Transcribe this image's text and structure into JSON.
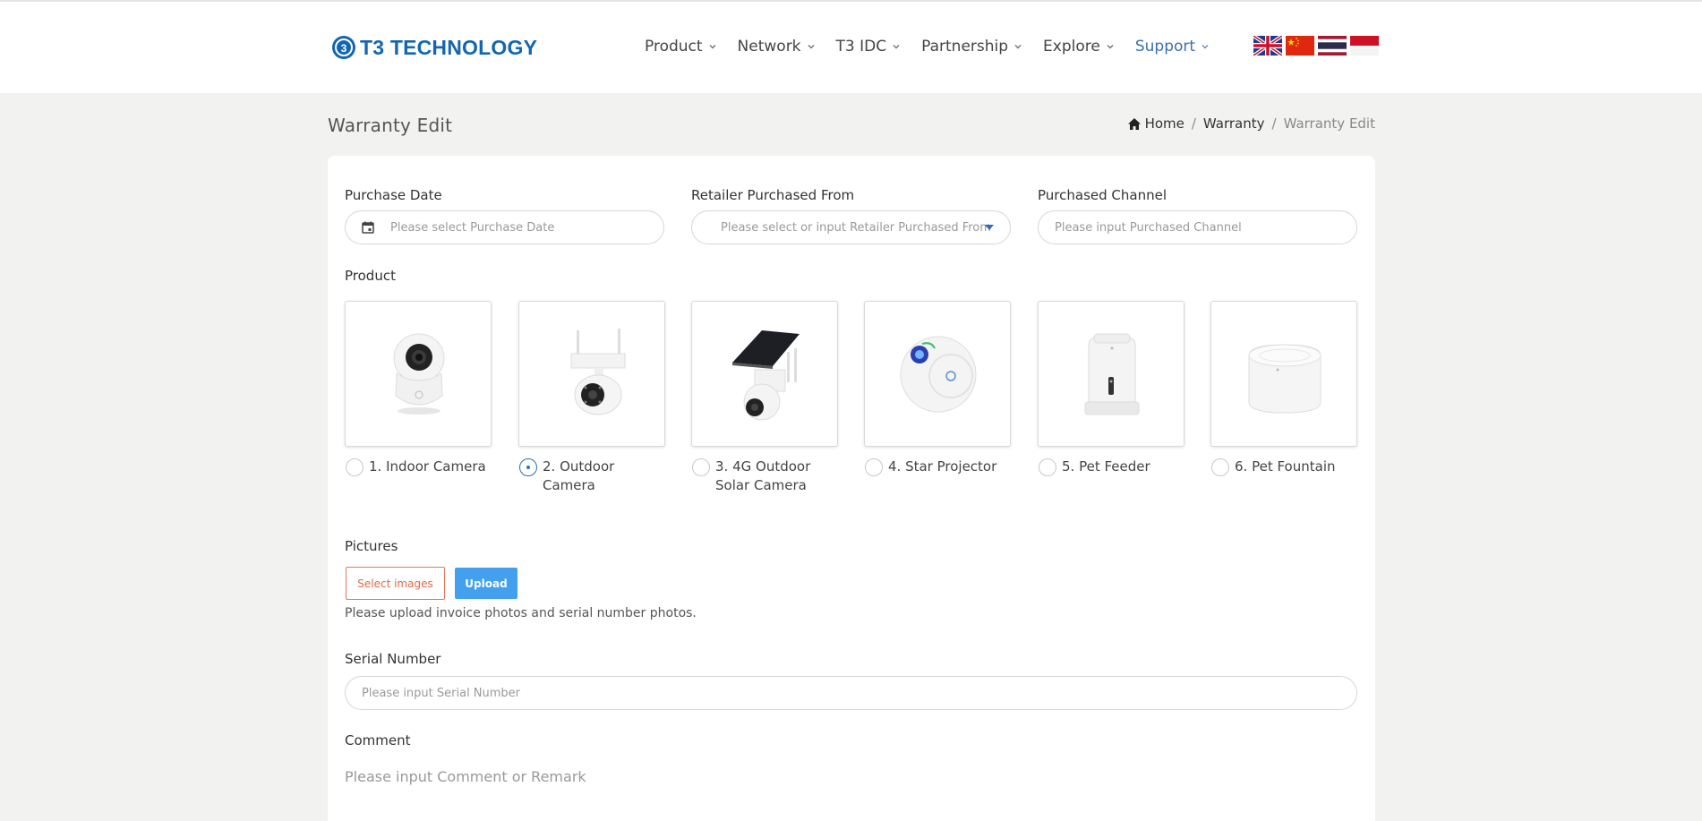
{
  "header": {
    "brand": "T3 TECHNOLOGY",
    "nav": [
      {
        "label": "Product"
      },
      {
        "label": "Network"
      },
      {
        "label": "T3 IDC"
      },
      {
        "label": "Partnership"
      },
      {
        "label": "Explore"
      },
      {
        "label": "Support",
        "active": true
      }
    ],
    "languages": [
      "english-flag-icon",
      "china-flag-icon",
      "thailand-flag-icon",
      "indonesia-flag-icon"
    ]
  },
  "page": {
    "title": "Warranty Edit",
    "breadcrumb": {
      "home": "Home",
      "parent": "Warranty",
      "current": "Warranty Edit"
    }
  },
  "form": {
    "purchase_date": {
      "label": "Purchase Date",
      "placeholder": "Please select Purchase Date"
    },
    "retailer": {
      "label": "Retailer Purchased From",
      "placeholder": "Please select or input Retailer Purchased From"
    },
    "channel": {
      "label": "Purchased Channel",
      "placeholder": "Please input Purchased Channel"
    },
    "product": {
      "label": "Product",
      "options": [
        {
          "label": "1. Indoor Camera",
          "checked": false
        },
        {
          "label": "2. Outdoor Camera",
          "checked": true
        },
        {
          "label": "3. 4G Outdoor Solar Camera",
          "checked": false
        },
        {
          "label": "4. Star Projector",
          "checked": false
        },
        {
          "label": "5. Pet Feeder",
          "checked": false
        },
        {
          "label": "6. Pet Fountain",
          "checked": false
        }
      ]
    },
    "pictures": {
      "label": "Pictures",
      "select_label": "Select images",
      "upload_label": "Upload",
      "hint": "Please upload invoice photos and serial number photos."
    },
    "serial": {
      "label": "Serial Number",
      "placeholder": "Please input Serial Number"
    },
    "comment": {
      "label": "Comment",
      "placeholder": "Please input Comment or Remark"
    }
  },
  "colors": {
    "brand": "#1466b0",
    "accent": "#42a0ef",
    "select_border": "#e07a5a",
    "background": "#f2f3f1"
  }
}
